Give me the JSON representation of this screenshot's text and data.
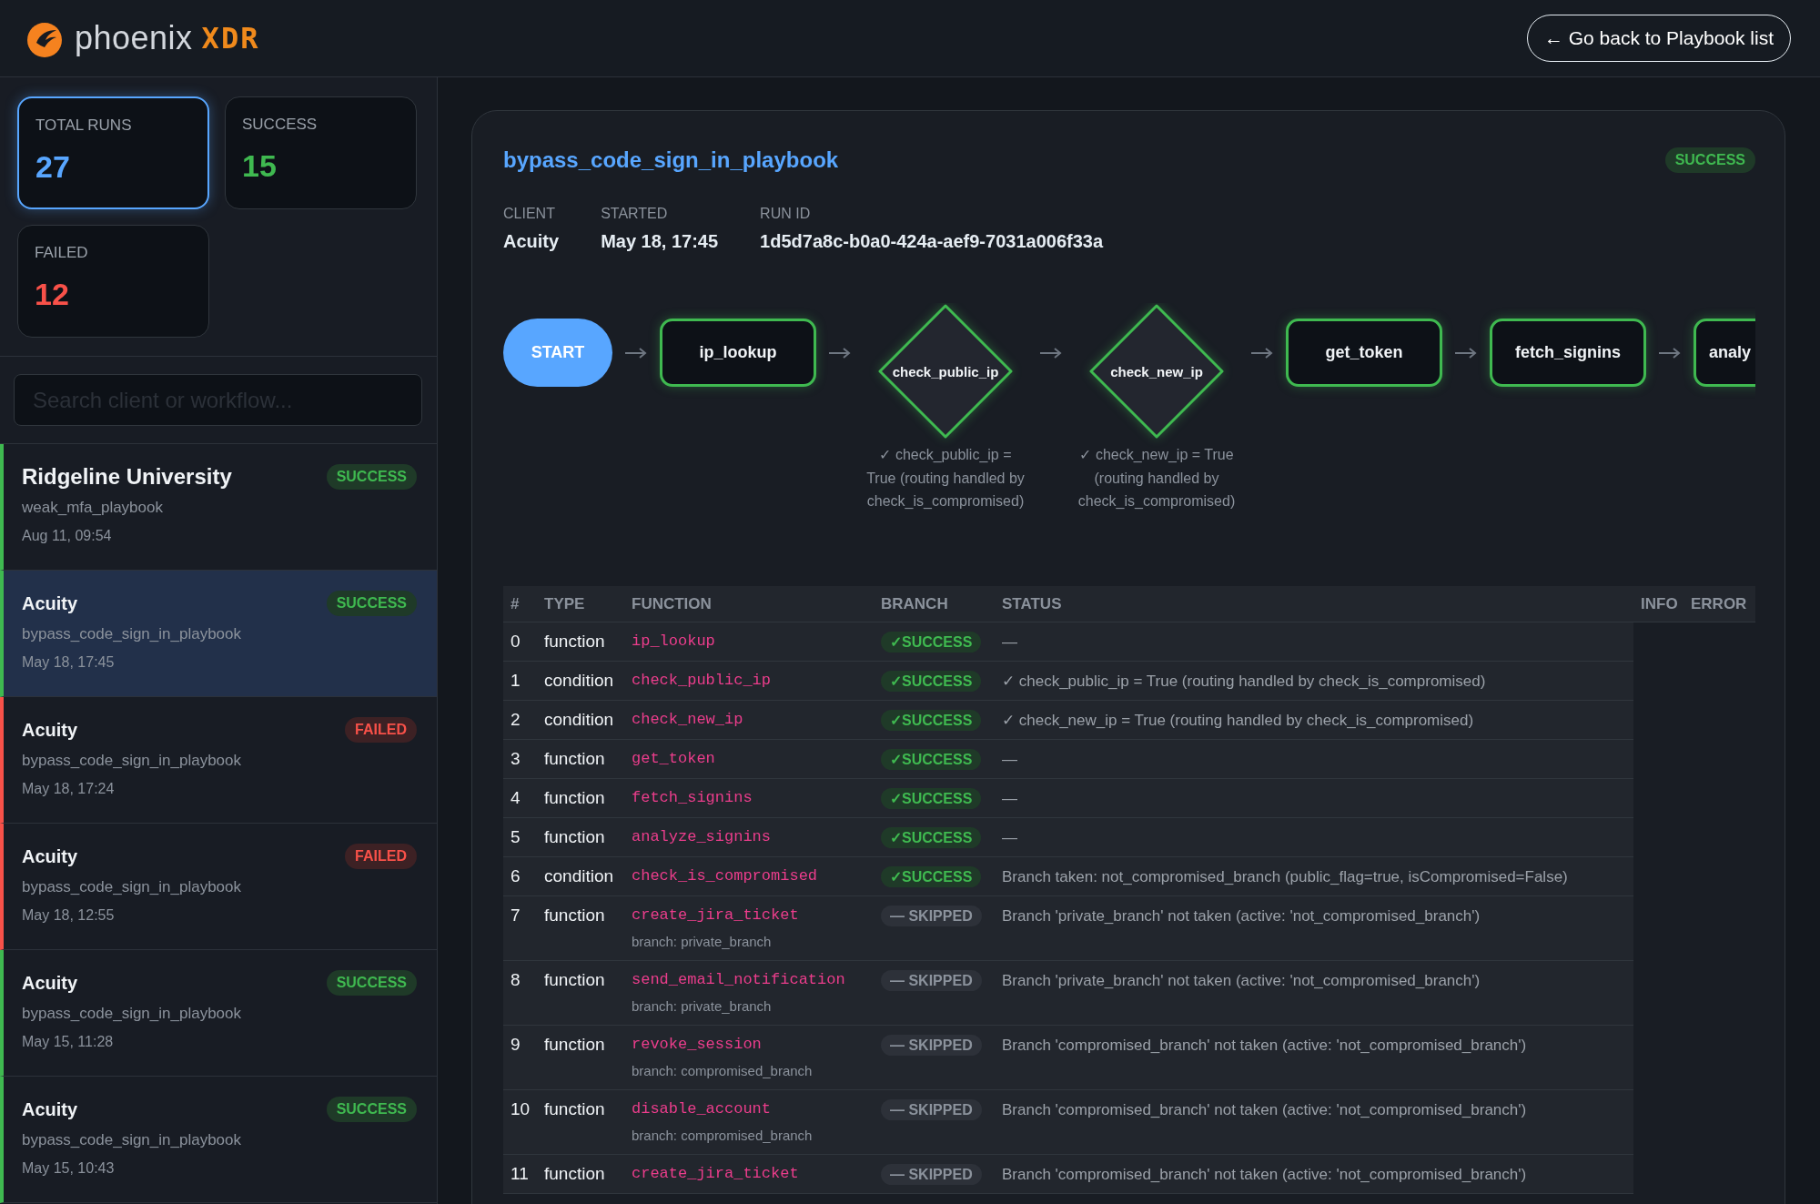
{
  "brand": {
    "name": "phoenix",
    "suffix": "XDR"
  },
  "back_button": {
    "label": "← Go back to Playbook list"
  },
  "stats": [
    {
      "label": "TOTAL RUNS",
      "value": "27",
      "color": "#58a6ff",
      "selected": true
    },
    {
      "label": "SUCCESS",
      "value": "15",
      "color": "#3fb950",
      "selected": false
    },
    {
      "label": "FAILED",
      "value": "12",
      "color": "#f85149",
      "selected": false
    }
  ],
  "search": {
    "placeholder": "Search client or workflow..."
  },
  "runs": [
    {
      "client": "Ridgeline University",
      "playbook": "weak_mfa_playbook",
      "time": "Aug 11, 09:54",
      "kind": "success",
      "badge": "SUCCESS",
      "selected": false
    },
    {
      "client": "Acuity",
      "playbook": "bypass_code_sign_in_playbook",
      "time": "May 18, 17:45",
      "kind": "success",
      "badge": "SUCCESS",
      "selected": true
    },
    {
      "client": "Acuity",
      "playbook": "bypass_code_sign_in_playbook",
      "time": "May 18, 17:24",
      "kind": "failed",
      "badge": "FAILED",
      "selected": false
    },
    {
      "client": "Acuity",
      "playbook": "bypass_code_sign_in_playbook",
      "time": "May 18, 12:55",
      "kind": "failed",
      "badge": "FAILED",
      "selected": false
    },
    {
      "client": "Acuity",
      "playbook": "bypass_code_sign_in_playbook",
      "time": "May 15, 11:28",
      "kind": "success",
      "badge": "SUCCESS",
      "selected": false
    },
    {
      "client": "Acuity",
      "playbook": "bypass_code_sign_in_playbook",
      "time": "May 15, 10:43",
      "kind": "success",
      "badge": "SUCCESS",
      "selected": false
    }
  ],
  "run": {
    "title": "bypass_code_sign_in_playbook",
    "kind": "success",
    "badge": "SUCCESS",
    "meta": [
      {
        "label": "CLIENT",
        "value": "Acuity"
      },
      {
        "label": "STARTED",
        "value": "May 18, 17:45"
      },
      {
        "label": "RUN ID",
        "value": "1d5d7a8c-b0a0-424a-aef9-7031a006f33a"
      }
    ]
  },
  "flow": [
    {
      "kind": "start",
      "label": "START"
    },
    {
      "kind": "task",
      "label": "ip_lookup"
    },
    {
      "kind": "condition",
      "label": "check_public_ip",
      "caption": "✓ check_public_ip = True (routing handled by check_is_compromised)"
    },
    {
      "kind": "condition",
      "label": "check_new_ip",
      "caption": "✓ check_new_ip = True (routing handled by check_is_compromised)"
    },
    {
      "kind": "task",
      "label": "get_token"
    },
    {
      "kind": "task",
      "label": "fetch_signins"
    },
    {
      "kind": "task",
      "label": "analy"
    }
  ],
  "table": {
    "columns": [
      "#",
      "TYPE",
      "FUNCTION",
      "BRANCH",
      "STATUS",
      "INFO",
      "ERROR"
    ],
    "rows": [
      {
        "index": "0",
        "type": "function",
        "function": "ip_lookup",
        "kind": "success",
        "badge": "✓SUCCESS",
        "message": "—"
      },
      {
        "index": "1",
        "type": "condition",
        "function": "check_public_ip",
        "kind": "success",
        "badge": "✓SUCCESS",
        "message": "✓ check_public_ip = True (routing handled by check_is_compromised)"
      },
      {
        "index": "2",
        "type": "condition",
        "function": "check_new_ip",
        "kind": "success",
        "badge": "✓SUCCESS",
        "message": "✓ check_new_ip = True (routing handled by check_is_compromised)"
      },
      {
        "index": "3",
        "type": "function",
        "function": "get_token",
        "kind": "success",
        "badge": "✓SUCCESS",
        "message": "—"
      },
      {
        "index": "4",
        "type": "function",
        "function": "fetch_signins",
        "kind": "success",
        "badge": "✓SUCCESS",
        "message": "—"
      },
      {
        "index": "5",
        "type": "function",
        "function": "analyze_signins",
        "kind": "success",
        "badge": "✓SUCCESS",
        "message": "—"
      },
      {
        "index": "6",
        "type": "condition",
        "function": "check_is_compromised",
        "kind": "success",
        "badge": "✓SUCCESS",
        "message": "Branch taken: not_compromised_branch (public_flag=true, isCompromised=False)"
      },
      {
        "index": "7",
        "type": "function",
        "function": "create_jira_ticket",
        "branch": "branch: private_branch",
        "kind": "skipped",
        "badge": "— SKIPPED",
        "message": "Branch 'private_branch' not taken (active: 'not_compromised_branch')"
      },
      {
        "index": "8",
        "type": "function",
        "function": "send_email_notification",
        "branch": "branch: private_branch",
        "kind": "skipped",
        "badge": "— SKIPPED",
        "message": "Branch 'private_branch' not taken (active: 'not_compromised_branch')"
      },
      {
        "index": "9",
        "type": "function",
        "function": "revoke_session",
        "branch": "branch: compromised_branch",
        "kind": "skipped",
        "badge": "— SKIPPED",
        "message": "Branch 'compromised_branch' not taken (active: 'not_compromised_branch')"
      },
      {
        "index": "10",
        "type": "function",
        "function": "disable_account",
        "branch": "branch: compromised_branch",
        "kind": "skipped",
        "badge": "— SKIPPED",
        "message": "Branch 'compromised_branch' not taken (active: 'not_compromised_branch')"
      },
      {
        "index": "11",
        "type": "function",
        "function": "create_jira_ticket",
        "kind": "skipped",
        "badge": "— SKIPPED",
        "message": "Branch 'compromised_branch' not taken (active: 'not_compromised_branch')"
      }
    ]
  }
}
